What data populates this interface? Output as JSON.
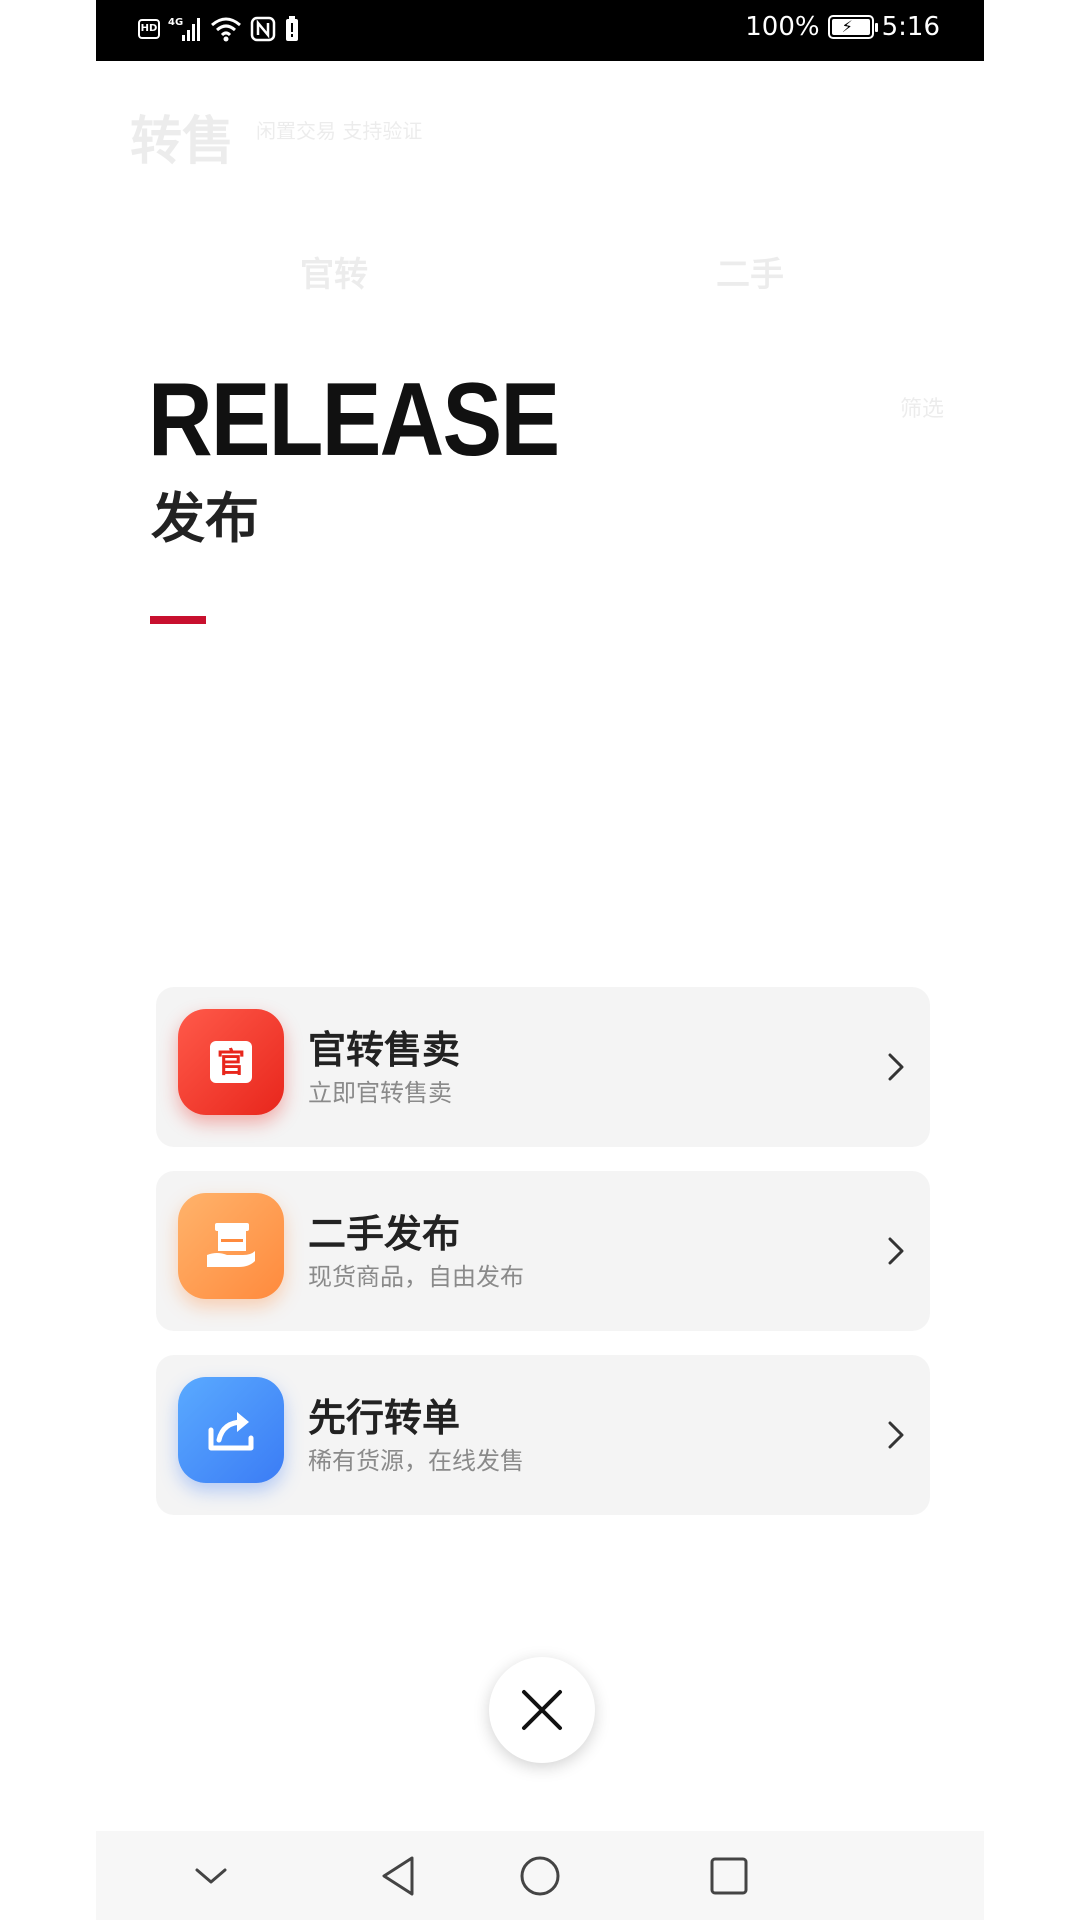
{
  "status_bar": {
    "network": "4G",
    "battery": "100%",
    "time": "5:16"
  },
  "background": {
    "title": "转售",
    "search_placeholder": "闲置交易 支持验证",
    "tabs": [
      "官转",
      "二手"
    ],
    "filter": "筛选"
  },
  "heading": {
    "title_en": "RELEASE",
    "title_cn": "发布",
    "accent_color": "#c8102e"
  },
  "options": [
    {
      "title": "官转售卖",
      "subtitle": "立即官转售卖",
      "icon": "official-badge-icon",
      "icon_glyph": "官",
      "color": "#e8261c"
    },
    {
      "title": "二手发布",
      "subtitle": "现货商品，自由发布",
      "icon": "box-hand-icon",
      "color": "#ff8a3d"
    },
    {
      "title": "先行转单",
      "subtitle": "稀有货源，在线发售",
      "icon": "share-forward-icon",
      "color": "#3b7cf5"
    }
  ],
  "close": {
    "icon": "close-icon"
  },
  "nav": [
    "chevron-down-icon",
    "back-icon",
    "home-icon",
    "recents-icon"
  ]
}
